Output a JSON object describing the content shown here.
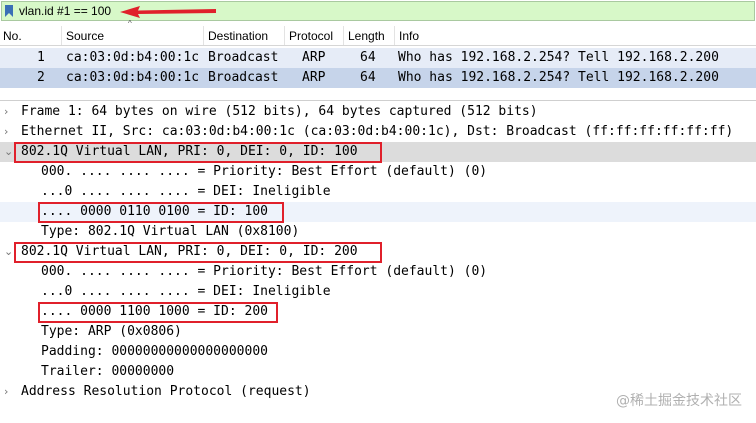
{
  "filter": {
    "text": "vlan.id #1 == 100"
  },
  "packet_list": {
    "columns": [
      "No.",
      "Source",
      "Destination",
      "Protocol",
      "Length",
      "Info"
    ],
    "rows": [
      {
        "no": "1",
        "source": "ca:03:0d:b4:00:1c",
        "destination": "Broadcast",
        "protocol": "ARP",
        "length": "64",
        "info": "Who has 192.168.2.254? Tell 192.168.2.200"
      },
      {
        "no": "2",
        "source": "ca:03:0d:b4:00:1c",
        "destination": "Broadcast",
        "protocol": "ARP",
        "length": "64",
        "info": "Who has 192.168.2.254? Tell 192.168.2.200"
      }
    ]
  },
  "details": {
    "frame": "Frame 1: 64 bytes on wire (512 bits), 64 bytes captured (512 bits)",
    "ethernet": "Ethernet II, Src: ca:03:0d:b4:00:1c (ca:03:0d:b4:00:1c), Dst: Broadcast (ff:ff:ff:ff:ff:ff)",
    "vlan1": {
      "title": "802.1Q Virtual LAN, PRI: 0, DEI: 0, ID: 100",
      "priority": "000. .... .... .... = Priority: Best Effort (default) (0)",
      "dei": "...0 .... .... .... = DEI: Ineligible",
      "id": ".... 0000 0110 0100 = ID: 100",
      "type": "Type: 802.1Q Virtual LAN (0x8100)"
    },
    "vlan2": {
      "title": "802.1Q Virtual LAN, PRI: 0, DEI: 0, ID: 200",
      "priority": "000. .... .... .... = Priority: Best Effort (default) (0)",
      "dei": "...0 .... .... .... = DEI: Ineligible",
      "id": ".... 0000 1100 1000 = ID: 200",
      "type": "Type: ARP (0x0806)",
      "padding": "Padding: 00000000000000000000",
      "trailer": "Trailer: 00000000"
    },
    "arp": "Address Resolution Protocol (request)"
  },
  "icons": {
    "expand_collapsed": "›",
    "expand_open": "⌄"
  },
  "watermark": "@稀土掘金技术社区",
  "colors": {
    "filter_ok": "#d7f8c8",
    "selected_row": "#c6d4ea",
    "annotation": "#e0202b"
  }
}
